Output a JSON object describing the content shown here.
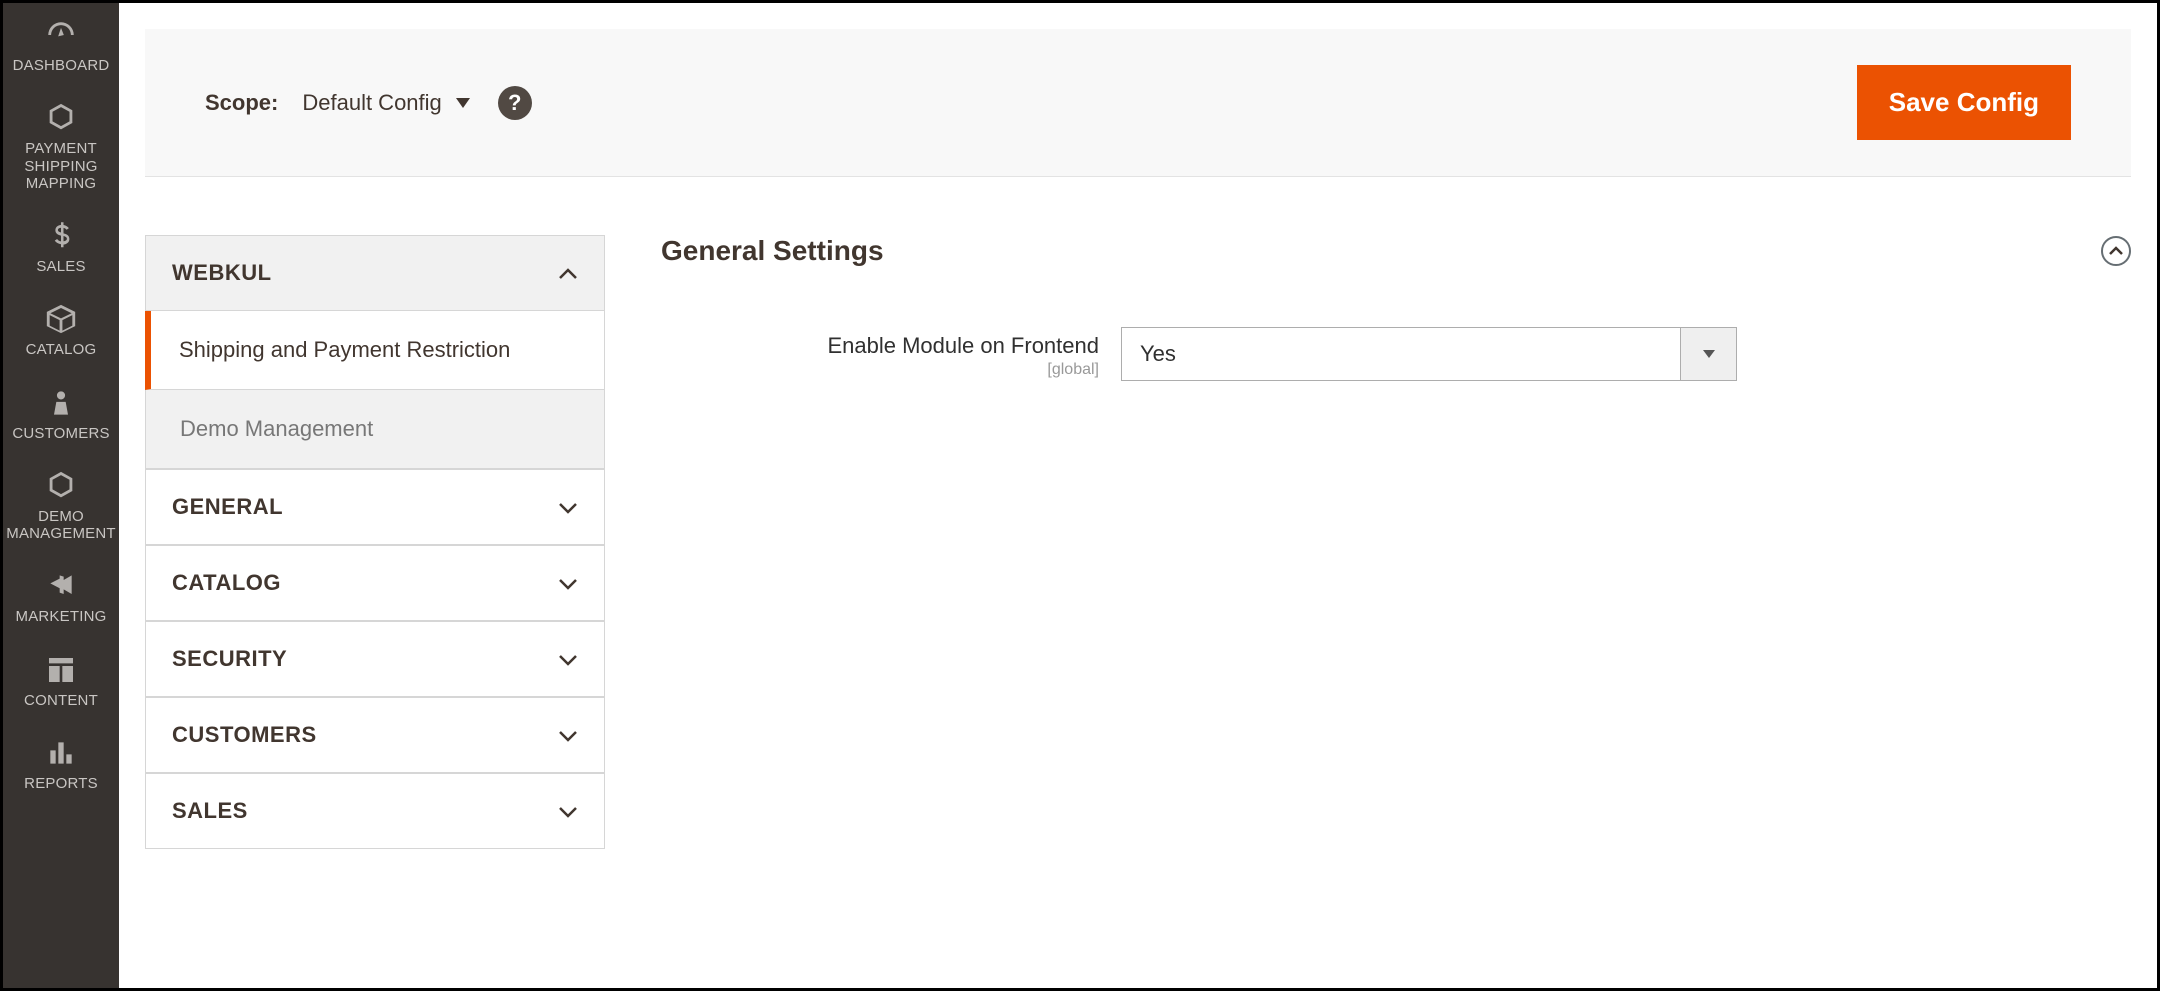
{
  "sidebar": {
    "items": [
      {
        "label": "DASHBOARD"
      },
      {
        "label": "PAYMENT SHIPPING MAPPING"
      },
      {
        "label": "SALES"
      },
      {
        "label": "CATALOG"
      },
      {
        "label": "CUSTOMERS"
      },
      {
        "label": "DEMO MANAGEMENT"
      },
      {
        "label": "MARKETING"
      },
      {
        "label": "CONTENT"
      },
      {
        "label": "REPORTS"
      }
    ]
  },
  "scope": {
    "label": "Scope:",
    "value": "Default Config",
    "help": "?"
  },
  "actions": {
    "save_label": "Save Config"
  },
  "config_tabs": {
    "sections": [
      {
        "title": "WEBKUL",
        "expanded": true,
        "items": [
          {
            "label": "Shipping and Payment Restriction",
            "active": true
          },
          {
            "label": "Demo Management",
            "active": false
          }
        ]
      },
      {
        "title": "GENERAL",
        "expanded": false
      },
      {
        "title": "CATALOG",
        "expanded": false
      },
      {
        "title": "SECURITY",
        "expanded": false
      },
      {
        "title": "CUSTOMERS",
        "expanded": false
      },
      {
        "title": "SALES",
        "expanded": false
      }
    ]
  },
  "settings": {
    "header": "General Settings",
    "fields": [
      {
        "label": "Enable Module on Frontend",
        "scope": "[global]",
        "value": "Yes"
      }
    ]
  }
}
